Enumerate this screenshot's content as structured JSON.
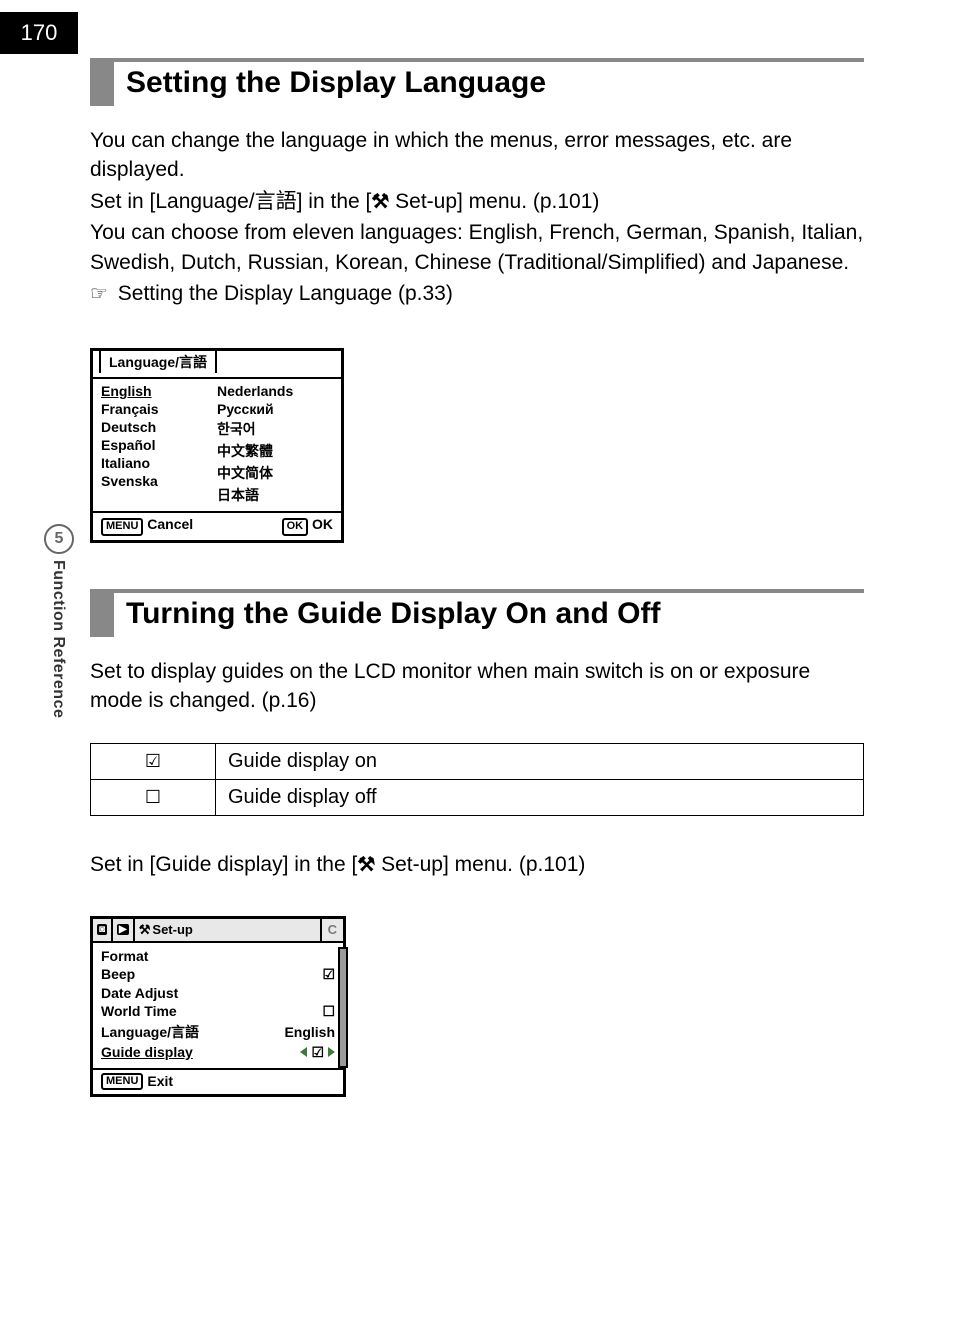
{
  "page_number": "170",
  "sidebar": {
    "chapter_num": "5",
    "chapter_label": "Function Reference"
  },
  "section1": {
    "heading": "Setting the Display Language",
    "para1": "You can change the language in which the menus, error messages, etc. are displayed.",
    "para2a": "Set in [Language/言語] in the [",
    "para2_tool": "⚒",
    "para2b": " Set-up] menu. (p.101)",
    "para3": "You can choose from eleven languages: English, French, German, Spanish, Italian, Swedish, Dutch, Russian, Korean, Chinese (Traditional/Simplified) and Japanese.",
    "xref_icon": "☞",
    "xref": " Setting the Display Language (p.33)"
  },
  "lang_menu": {
    "title": "Language/言語",
    "left": [
      "English",
      "Français",
      "Deutsch",
      "Español",
      "Italiano",
      "Svenska"
    ],
    "right": [
      "Nederlands",
      "Русский",
      "한국어",
      "中文繁體",
      "中文简体",
      "日本語"
    ],
    "footer_left_btn": "MENU",
    "footer_left_label": "Cancel",
    "footer_right_btn": "OK",
    "footer_right_label": "OK"
  },
  "section2": {
    "heading": "Turning the Guide Display On and Off",
    "para1": "Set to display guides on the LCD monitor when main switch is on or exposure mode is changed. (p.16)",
    "table": {
      "row1_icon": "☑",
      "row1_label": "Guide display on",
      "row2_icon": "☐",
      "row2_label": "Guide display off"
    },
    "para2a": "Set in [Guide display] in the [",
    "para2_tool": "⚒",
    "para2b": " Set-up] menu. (p.101)"
  },
  "setup_menu": {
    "tab_cam": "◙",
    "tab_play": "▶",
    "tab_tool": "⚒",
    "tab_setup_label": "Set-up",
    "tab_c": "C",
    "rows": {
      "r0": {
        "label": "Format",
        "val": ""
      },
      "r1": {
        "label": "Beep",
        "val": "☑"
      },
      "r2": {
        "label": "Date Adjust",
        "val": ""
      },
      "r3": {
        "label": "World Time",
        "val": "☐"
      },
      "r4": {
        "label": "Language/言語",
        "val": "English"
      },
      "r5": {
        "label": "Guide display",
        "val": "☑"
      }
    },
    "footer_btn": "MENU",
    "footer_label": "Exit"
  }
}
